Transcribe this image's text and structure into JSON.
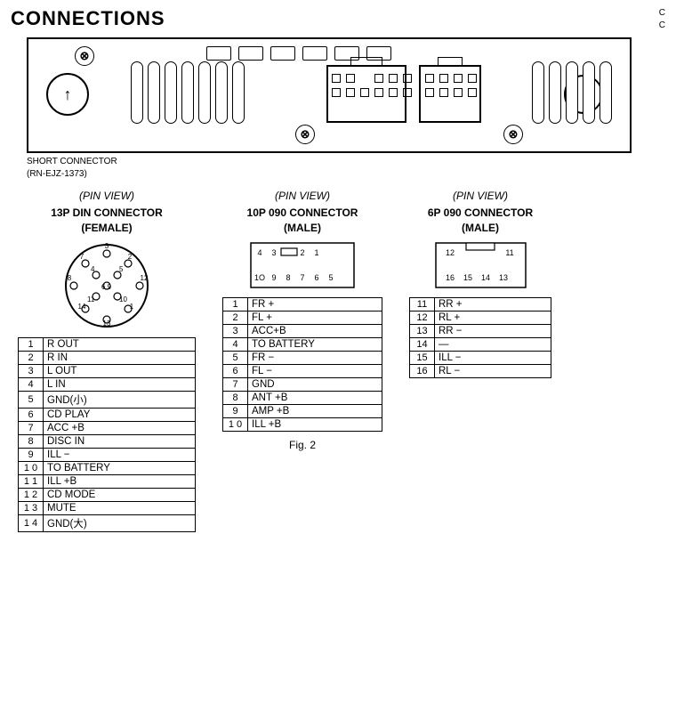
{
  "page": {
    "title": "CONNECTIONS",
    "top_right": "C\nC",
    "short_connector_label": "SHORT CONNECTOR\n(RN-EJZ-1373)",
    "fig_label": "Fig. 2"
  },
  "left_table": {
    "pin_view": "(PIN  VIEW)",
    "heading": "13P DIN CONNECTOR\n(FEMALE)",
    "rows": [
      {
        "pin": "1",
        "signal": "R OUT"
      },
      {
        "pin": "2",
        "signal": "R IN"
      },
      {
        "pin": "3",
        "signal": "L OUT"
      },
      {
        "pin": "4",
        "signal": "L IN"
      },
      {
        "pin": "5",
        "signal": "GND(小)"
      },
      {
        "pin": "6",
        "signal": "CD PLAY"
      },
      {
        "pin": "7",
        "signal": "ACC +B"
      },
      {
        "pin": "8",
        "signal": "DISC IN"
      },
      {
        "pin": "9",
        "signal": "ILL −"
      },
      {
        "pin": "1 0",
        "signal": "TO BATTERY"
      },
      {
        "pin": "1 1",
        "signal": "ILL +B"
      },
      {
        "pin": "1 2",
        "signal": "CD MODE"
      },
      {
        "pin": "1 3",
        "signal": "MUTE"
      },
      {
        "pin": "1 4",
        "signal": "GND(大)"
      }
    ]
  },
  "center_table": {
    "pin_view": "(PIN  VIEW)",
    "heading": "10P 090 CONNECTOR\n(MALE)",
    "rows": [
      {
        "pin": "1",
        "signal": "FR +"
      },
      {
        "pin": "2",
        "signal": "FL +"
      },
      {
        "pin": "3",
        "signal": "ACC+B"
      },
      {
        "pin": "4",
        "signal": "TO BATTERY"
      },
      {
        "pin": "5",
        "signal": "FR −"
      },
      {
        "pin": "6",
        "signal": "FL −"
      },
      {
        "pin": "7",
        "signal": "GND"
      },
      {
        "pin": "8",
        "signal": "ANT +B"
      },
      {
        "pin": "9",
        "signal": "AMP +B"
      },
      {
        "pin": "1 0",
        "signal": "ILL +B"
      }
    ]
  },
  "right_table": {
    "pin_view": "(PIN  VIEW)",
    "heading": "6P 090 CONNECTOR\n(MALE)",
    "rows": [
      {
        "pin": "11",
        "signal": "RR +"
      },
      {
        "pin": "12",
        "signal": "RL +"
      },
      {
        "pin": "13",
        "signal": "RR −"
      },
      {
        "pin": "14",
        "signal": "—"
      },
      {
        "pin": "15",
        "signal": "ILL −"
      },
      {
        "pin": "16",
        "signal": "RL −"
      }
    ]
  }
}
